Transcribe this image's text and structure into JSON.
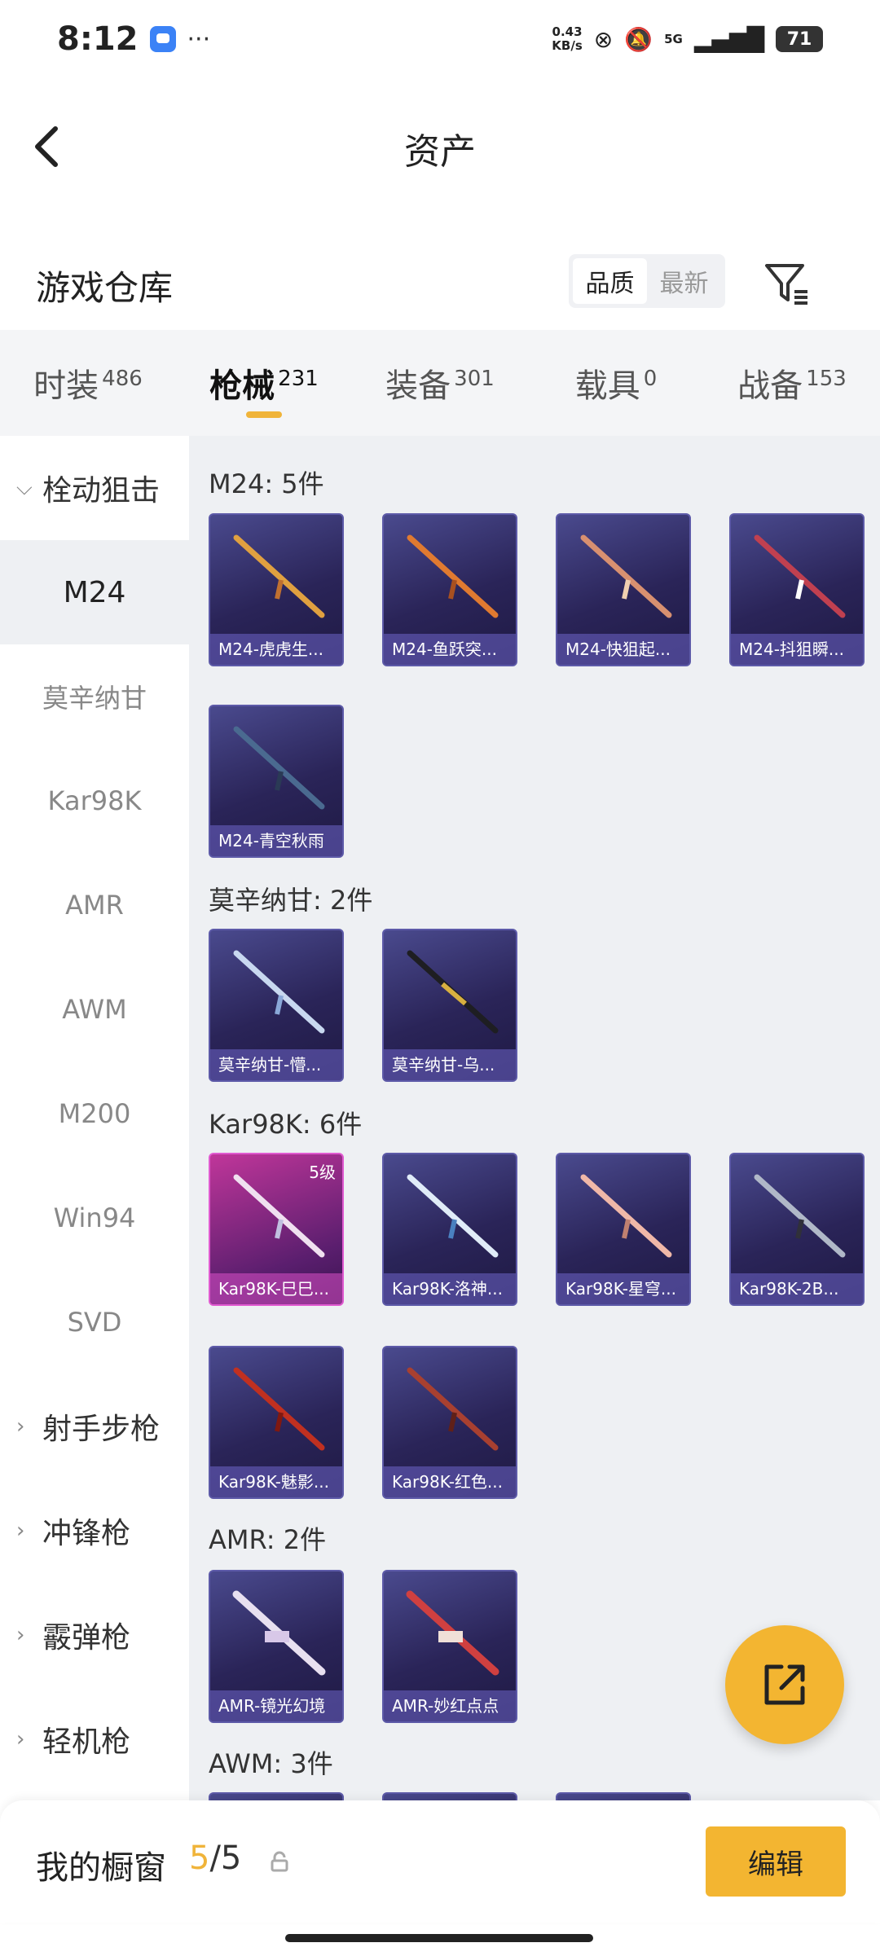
{
  "status": {
    "time": "8:12",
    "more": "···",
    "speed_value": "0.43",
    "speed_unit": "KB/s",
    "network": "5G",
    "battery": "71"
  },
  "header": {
    "title": "资产"
  },
  "warehouse": {
    "title": "游戏仓库",
    "sort_quality": "品质",
    "sort_newest": "最新"
  },
  "tabs": [
    {
      "label": "时装",
      "count": "486"
    },
    {
      "label": "枪械",
      "count": "231"
    },
    {
      "label": "装备",
      "count": "301"
    },
    {
      "label": "载具",
      "count": "0"
    },
    {
      "label": "战备",
      "count": "153"
    }
  ],
  "sidebar": {
    "items": [
      {
        "label": "栓动狙击"
      },
      {
        "label": "M24"
      },
      {
        "label": "莫辛纳甘"
      },
      {
        "label": "Kar98K"
      },
      {
        "label": "AMR"
      },
      {
        "label": "AWM"
      },
      {
        "label": "M200"
      },
      {
        "label": "Win94"
      },
      {
        "label": "SVD"
      },
      {
        "label": "射手步枪"
      },
      {
        "label": "冲锋枪"
      },
      {
        "label": "霰弹枪"
      },
      {
        "label": "轻机枪"
      }
    ]
  },
  "sections": [
    {
      "title": "M24: 5件",
      "items": [
        "M24-虎虎生...",
        "M24-鱼跃突...",
        "M24-快狙起...",
        "M24-抖狙瞬...",
        "M24-青空秋雨"
      ]
    },
    {
      "title": "莫辛纳甘: 2件",
      "items": [
        "莫辛纳甘-懵...",
        "莫辛纳甘-乌..."
      ]
    },
    {
      "title": "Kar98K: 6件",
      "items": [
        "Kar98K-巳巳...",
        "Kar98K-洛神...",
        "Kar98K-星穹...",
        "Kar98K-2B...",
        "Kar98K-魅影...",
        "Kar98K-红色..."
      ],
      "badge": "5级"
    },
    {
      "title": "AMR: 2件",
      "items": [
        "AMR-镜光幻境",
        "AMR-妙红点点"
      ]
    },
    {
      "title": "AWM: 3件"
    }
  ],
  "bottom": {
    "title": "我的橱窗",
    "current": "5",
    "total": "/5",
    "edit": "编辑"
  },
  "colors": {
    "accent": "#f3b531",
    "card_blue": "#2a2458",
    "card_legend": "#c0369a"
  },
  "icons": [
    "back-arrow-icon",
    "filter-icon",
    "share-icon",
    "lock-icon",
    "chevron-down-icon",
    "chevron-right-icon"
  ]
}
